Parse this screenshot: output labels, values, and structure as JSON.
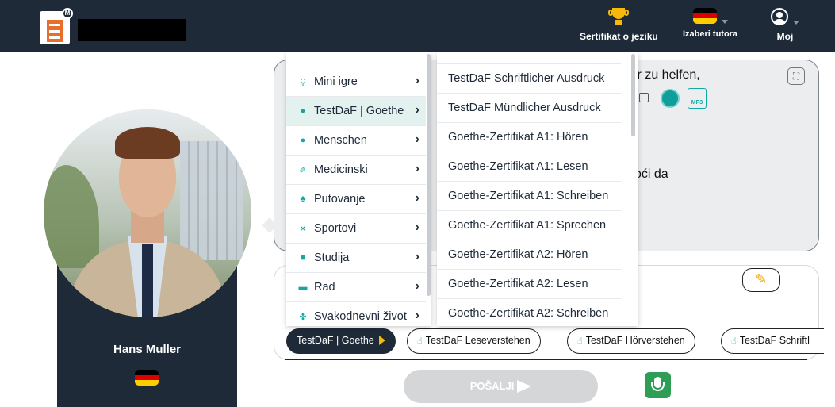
{
  "header": {
    "certificate_label": "Sertifikat o jeziku",
    "choose_tutor_label": "Izaberi tutora",
    "profile_label": "Moj"
  },
  "tutor": {
    "name": "Hans Muller",
    "flag_colors": [
      "#000000",
      "#dd0000",
      "#ffce00"
    ]
  },
  "bubble": {
    "text_line1": "ir zu helfen,",
    "text_line2": "oći da",
    "mp3_label": "MP3"
  },
  "categories_menu": [
    {
      "label": "Mini igre",
      "icon": "bike-icon"
    },
    {
      "label": "TestDaF | Goethe",
      "icon": "chat-icon",
      "active": true
    },
    {
      "label": "Menschen",
      "icon": "chat-icon"
    },
    {
      "label": "Medicinski",
      "icon": "syringe-icon"
    },
    {
      "label": "Putovanje",
      "icon": "palm-tree-icon"
    },
    {
      "label": "Sportovi",
      "icon": "sports-icon"
    },
    {
      "label": "Studija",
      "icon": "book-icon"
    },
    {
      "label": "Rad",
      "icon": "briefcase-icon"
    },
    {
      "label": "Svakodnevni život",
      "icon": "clover-icon"
    }
  ],
  "submenu": [
    "TestDaF Schriftlicher Ausdruck",
    "TestDaF Mündlicher Ausdruck",
    "Goethe-Zertifikat A1: Hören",
    "Goethe-Zertifikat A1: Lesen",
    "Goethe-Zertifikat A1: Schreiben",
    "Goethe-Zertifikat A1: Sprechen",
    "Goethe-Zertifikat A2: Hören",
    "Goethe-Zertifikat A2: Lesen",
    "Goethe-Zertifikat A2: Schreiben"
  ],
  "chips": {
    "active": "TestDaF | Goethe",
    "items": [
      "TestDaF Leseverstehen",
      "TestDaF Hörverstehen",
      "TestDaF Schriftl"
    ]
  },
  "send_label": "POŠALJI",
  "colors": {
    "navy": "#1f2a38",
    "accent_teal": "#12a8a2",
    "trophy_gold": "#f5b90b",
    "mic_green": "#2f9e55"
  }
}
